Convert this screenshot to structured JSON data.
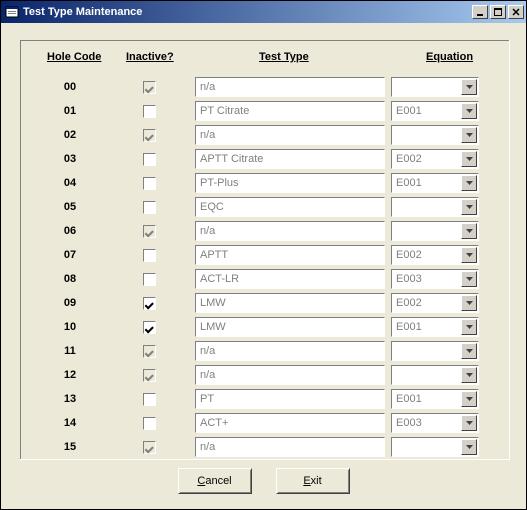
{
  "window": {
    "title": "Test Type Maintenance"
  },
  "headers": {
    "hole_code": "Hole Code",
    "inactive": "Inactive?",
    "test_type": "Test Type",
    "equation": "Equation"
  },
  "rows": [
    {
      "code": "00",
      "inactive": true,
      "inactive_enabled": false,
      "test_type": "n/a",
      "equation": ""
    },
    {
      "code": "01",
      "inactive": false,
      "inactive_enabled": true,
      "test_type": "PT Citrate",
      "equation": "E001"
    },
    {
      "code": "02",
      "inactive": true,
      "inactive_enabled": false,
      "test_type": "n/a",
      "equation": ""
    },
    {
      "code": "03",
      "inactive": false,
      "inactive_enabled": true,
      "test_type": "APTT Citrate",
      "equation": "E002"
    },
    {
      "code": "04",
      "inactive": false,
      "inactive_enabled": true,
      "test_type": "PT-Plus",
      "equation": "E001"
    },
    {
      "code": "05",
      "inactive": false,
      "inactive_enabled": true,
      "test_type": "EQC",
      "equation": ""
    },
    {
      "code": "06",
      "inactive": true,
      "inactive_enabled": false,
      "test_type": "n/a",
      "equation": ""
    },
    {
      "code": "07",
      "inactive": false,
      "inactive_enabled": true,
      "test_type": "APTT",
      "equation": "E002"
    },
    {
      "code": "08",
      "inactive": false,
      "inactive_enabled": true,
      "test_type": "ACT-LR",
      "equation": "E003"
    },
    {
      "code": "09",
      "inactive": true,
      "inactive_enabled": true,
      "test_type": "LMW",
      "equation": "E002"
    },
    {
      "code": "10",
      "inactive": true,
      "inactive_enabled": true,
      "test_type": "LMW",
      "equation": "E001"
    },
    {
      "code": "11",
      "inactive": true,
      "inactive_enabled": false,
      "test_type": "n/a",
      "equation": ""
    },
    {
      "code": "12",
      "inactive": true,
      "inactive_enabled": false,
      "test_type": "n/a",
      "equation": ""
    },
    {
      "code": "13",
      "inactive": false,
      "inactive_enabled": true,
      "test_type": "PT",
      "equation": "E001"
    },
    {
      "code": "14",
      "inactive": false,
      "inactive_enabled": true,
      "test_type": "ACT+",
      "equation": "E003"
    },
    {
      "code": "15",
      "inactive": true,
      "inactive_enabled": false,
      "test_type": "n/a",
      "equation": ""
    }
  ],
  "buttons": {
    "cancel": "Cancel",
    "exit": "Exit"
  }
}
